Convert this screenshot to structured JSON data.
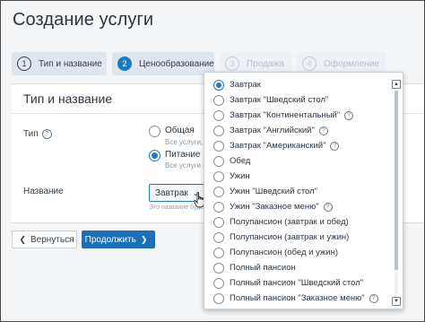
{
  "page": {
    "title": "Создание услуги"
  },
  "steps": [
    {
      "num": "1",
      "label": "Тип и название"
    },
    {
      "num": "2",
      "label": "Ценообразование"
    },
    {
      "num": "3",
      "label": "Продажа"
    },
    {
      "num": "4",
      "label": "Оформление"
    }
  ],
  "card": {
    "title": "Тип и название",
    "type_label": "Тип",
    "type_options": [
      {
        "title": "Общая",
        "sub": "Все услуги, к",
        "checked": false
      },
      {
        "title": "Питание",
        "sub": "Все услуги п",
        "checked": true
      }
    ],
    "name_label": "Название",
    "select_value": "Завтрак",
    "select_hint": "Это название будет"
  },
  "buttons": {
    "back": "Вернуться",
    "next": "Продолжить"
  },
  "dropdown": {
    "items": [
      {
        "label": "Завтрак",
        "selected": true,
        "help": false
      },
      {
        "label": "Завтрак \"Шведский стол\"",
        "selected": false,
        "help": false
      },
      {
        "label": "Завтрак \"Континентальный\"",
        "selected": false,
        "help": true
      },
      {
        "label": "Завтрак \"Английский\"",
        "selected": false,
        "help": true
      },
      {
        "label": "Завтрак \"Американский\"",
        "selected": false,
        "help": true
      },
      {
        "label": "Обед",
        "selected": false,
        "help": false
      },
      {
        "label": "Ужин",
        "selected": false,
        "help": false
      },
      {
        "label": "Ужин \"Шведский стол\"",
        "selected": false,
        "help": false
      },
      {
        "label": "Ужин \"Заказное меню\"",
        "selected": false,
        "help": true
      },
      {
        "label": "Полупансион (завтрак и обед)",
        "selected": false,
        "help": false
      },
      {
        "label": "Полупансион (завтрак и ужин)",
        "selected": false,
        "help": false
      },
      {
        "label": "Полупансион (обед и ужин)",
        "selected": false,
        "help": false
      },
      {
        "label": "Полный пансион",
        "selected": false,
        "help": false
      },
      {
        "label": "Полный пансион \"Шведский стол\"",
        "selected": false,
        "help": false
      },
      {
        "label": "Полный пансион \"Заказное меню\"",
        "selected": false,
        "help": true
      }
    ]
  },
  "colors": {
    "accent": "#1e7ac2",
    "button_primary": "#1e6fba"
  }
}
